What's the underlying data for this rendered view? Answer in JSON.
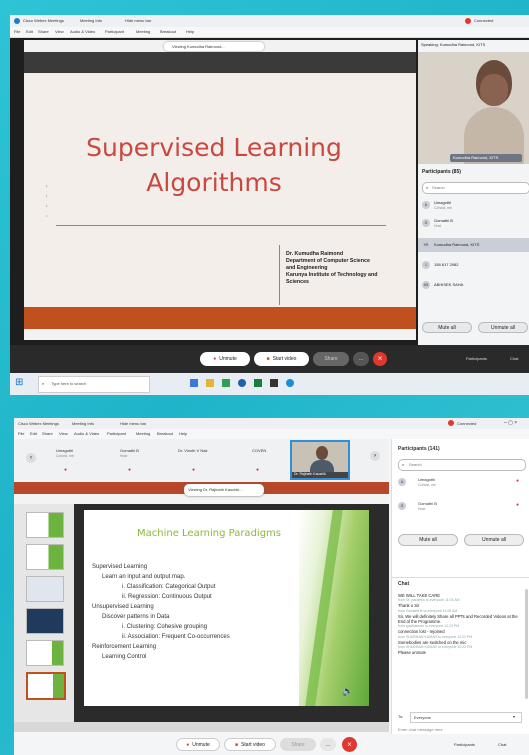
{
  "top": {
    "titlebar": {
      "app": "Cisco Webex Meetings",
      "meeting_info": "Meeting Info",
      "hide_menu": "Hide menu bar",
      "status": "Connected"
    },
    "menu": [
      "File",
      "Edit",
      "Share",
      "View",
      "Audio & Video",
      "Participant",
      "Meeting",
      "Breakout",
      "Help"
    ],
    "viewing_label": "Viewing Kumudha Raimond...",
    "slide": {
      "title_line1": "Supervised Learning",
      "title_line2": "Algorithms",
      "presenter_lines": [
        "Dr. Kumudha Raimond",
        "Department of Computer Science",
        "and Engineering",
        "Karunya Institute of Technology and",
        "Sciences"
      ]
    },
    "speaking_label": "Speaking: Kumudha Raimond, KITS",
    "video_name": "Kumudha Raimond, KITS",
    "participants": {
      "header": "Participants (85)",
      "search_placeholder": "Search",
      "items": [
        {
          "initials": "U",
          "name": "Umagothi",
          "sub": "Cohost, me"
        },
        {
          "initials": "G",
          "name": "Gomathi B",
          "sub": "Host"
        },
        {
          "initials": "KR",
          "name": "Kumudha Raimond, KITS",
          "sub": ""
        },
        {
          "initials": "1",
          "name": "158 617 2982",
          "sub": ""
        },
        {
          "initials": "AS",
          "name": "ABHISEK SAHA",
          "sub": ""
        }
      ],
      "mute_all": "Mute all",
      "unmute_all": "Unmute all"
    },
    "controls": {
      "unmute": "Unmute",
      "start_video": "Start video",
      "share": "Share"
    },
    "bottom_right": {
      "participants": "Participants",
      "chat": "Chat"
    },
    "taskbar": {
      "search_placeholder": "Type here to search"
    }
  },
  "bottom": {
    "titlebar": {
      "app": "Cisco Webex Meetings",
      "meeting_info": "Meeting Info",
      "hide_menu": "Hide menu bar",
      "status": "Connected"
    },
    "menu": [
      "File",
      "Edit",
      "Share",
      "View",
      "Audio & Video",
      "Participant",
      "Meeting",
      "Breakout",
      "Help"
    ],
    "strip_participants": [
      {
        "name": "Umagothi",
        "sub": "Cohost, me"
      },
      {
        "name": "Gomathi B",
        "sub": "Host"
      },
      {
        "name": "Dr. Vinoth V Nair",
        "sub": ""
      },
      {
        "name": "COVEN",
        "sub": ""
      }
    ],
    "video_name": "Dr. Rajinath Kaushik",
    "viewing_label": "Viewing Dr. Rajinath Kauchik...",
    "slide": {
      "title": "Machine Learning Paradigms",
      "lines": [
        {
          "indent": 0,
          "text": "Supervised Learning"
        },
        {
          "indent": 1,
          "text": "Learn an input and output map."
        },
        {
          "indent": 2,
          "text": "i.    Classification: Categorical Output"
        },
        {
          "indent": 2,
          "text": "ii.   Regression: Continuous Output"
        },
        {
          "indent": 0,
          "text": "Unsupervised Learning"
        },
        {
          "indent": 1,
          "text": "Discover patterns in Data"
        },
        {
          "indent": 2,
          "text": "i.    Clustering: Cohesive grouping"
        },
        {
          "indent": 2,
          "text": "ii.   Association: Frequent Co-occurrences"
        },
        {
          "indent": 0,
          "text": "Reinforcement Learning"
        },
        {
          "indent": 1,
          "text": "Learning Control"
        }
      ]
    },
    "participants": {
      "header": "Participants (141)",
      "search_placeholder": "Search",
      "items": [
        {
          "initials": "U",
          "name": "Umagothi",
          "sub": "Cohost, me"
        },
        {
          "initials": "G",
          "name": "Gomathi B",
          "sub": "Host"
        }
      ],
      "mute_all": "Mute all",
      "unmute_all": "Unmute all"
    },
    "chat": {
      "header": "Chat",
      "messages": [
        {
          "meta": "",
          "text": "WE WILL TAKE CARE"
        },
        {
          "meta": "from Dr. paramilo to everyone  11:04 AM",
          "text": "Thank u Sir"
        },
        {
          "meta": "from Gomathi B to everyone  11:06 AM",
          "text": "Sir, We will definitely Share all PPTs and Recorded Videos at the End of the Programme."
        },
        {
          "meta": "from gaathisham to everyone  12:22 PM",
          "text": "connection lost - rejoined"
        },
        {
          "meta": "from SHUBHAM KUMAR to everyone  12:22 PM",
          "text": "Somebodies are switched on the mic"
        },
        {
          "meta": "from SHUBHAM KUMAR to everyone  12:22 PM",
          "text": "Please unmute"
        }
      ],
      "to_label": "To:",
      "to_value": "Everyone",
      "input_placeholder": "Enter chat message here"
    },
    "controls": {
      "unmute": "Unmute",
      "start_video": "Start video",
      "share": "Share"
    },
    "bottom_right": {
      "participants": "Participants",
      "chat": "Chat"
    }
  },
  "colors": {
    "background": "#24bed0",
    "slide_title_red": "#c9483f",
    "webex_red": "#e0382e",
    "slide_green": "#6db33f",
    "title_green": "#8cb83a"
  }
}
